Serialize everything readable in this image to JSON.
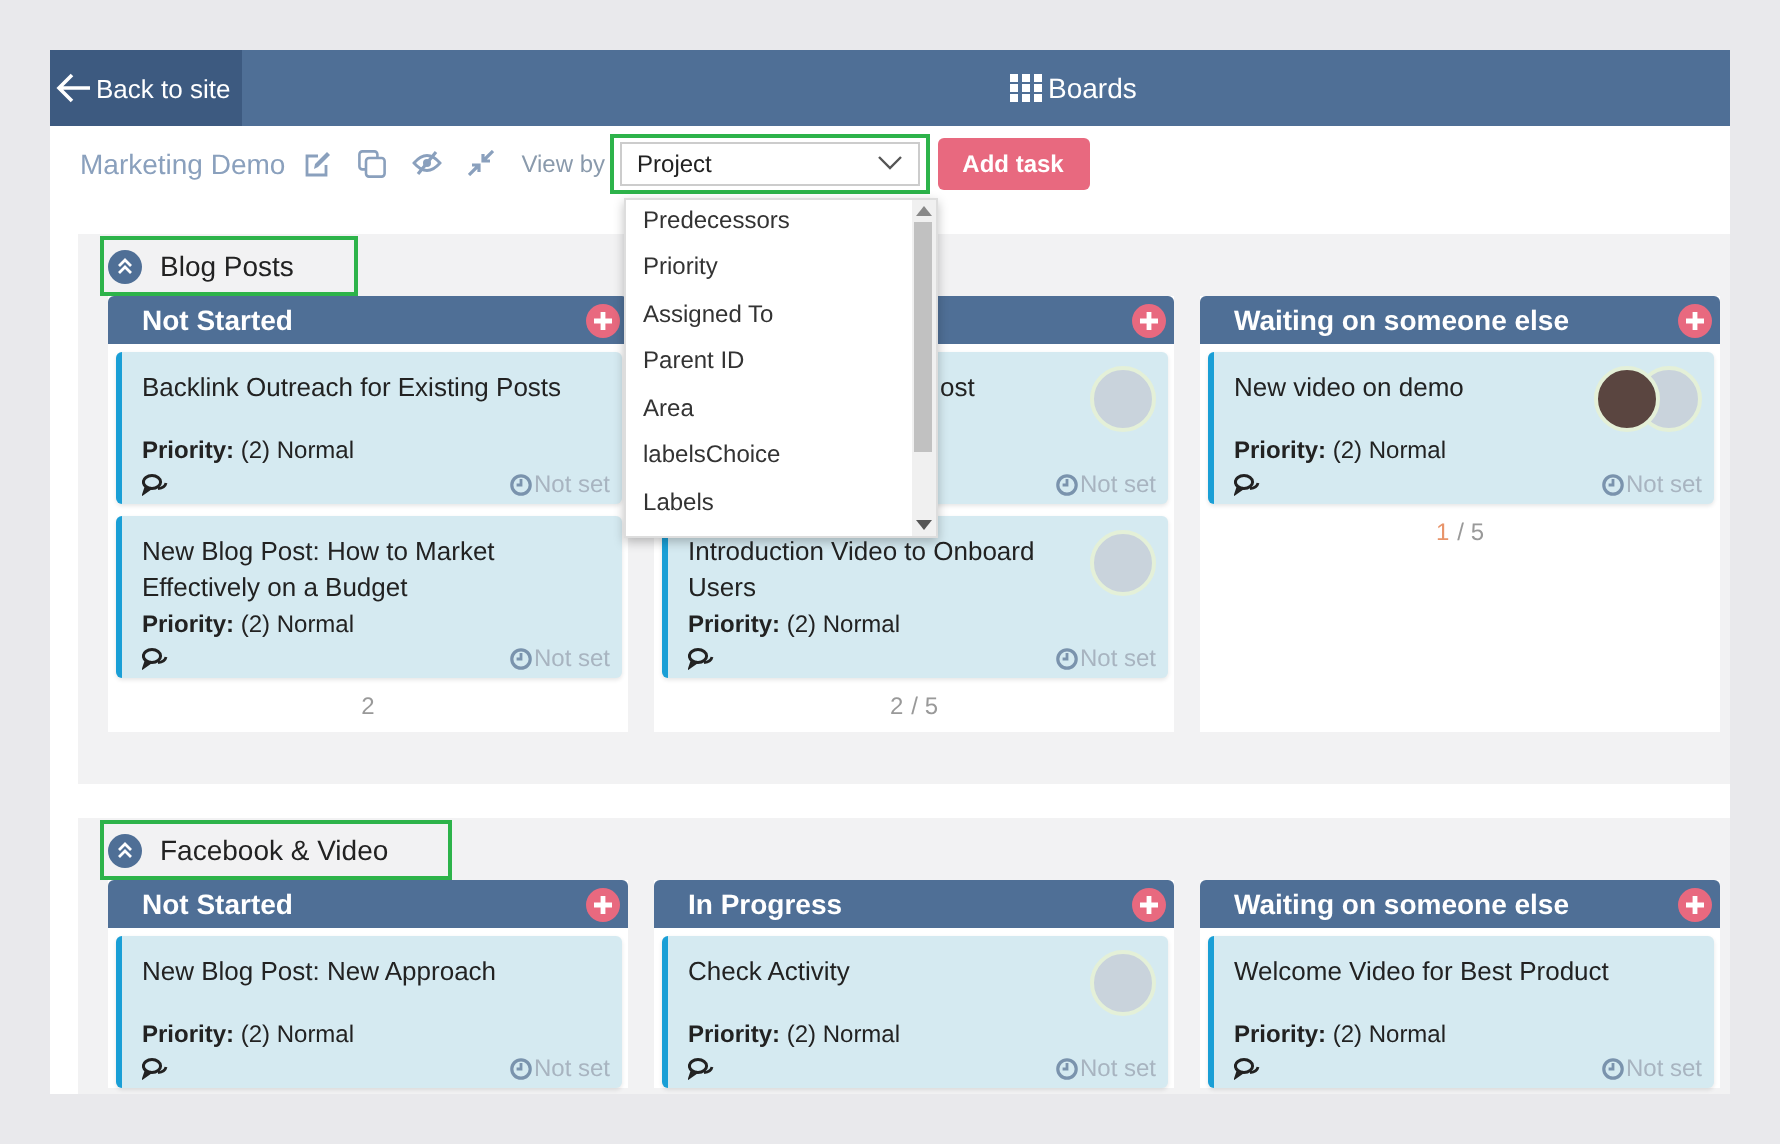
{
  "header": {
    "back_label": "Back to site",
    "title": "Boards"
  },
  "toolbar": {
    "board_name": "Marketing Demo",
    "view_by_label": "View by",
    "view_by": {
      "value": "Project",
      "highlighted": true,
      "expanded": true,
      "options": [
        "Predecessors",
        "Priority",
        "Assigned To",
        "Parent ID",
        "Area",
        "labelsChoice",
        "Labels"
      ]
    },
    "add_button": "Add task"
  },
  "sections": [
    {
      "title": "Blog Posts",
      "highlighted": true,
      "columns": [
        {
          "title": "Not Started",
          "cards": [
            {
              "title": "Backlink Outreach for Existing Posts",
              "covered": false,
              "priority_label": "Priority:",
              "priority": "(2) Normal",
              "due": "Not set"
            },
            {
              "title": "New Blog Post: How to Market Effectively on a Budget",
              "covered": false,
              "priority_label": "Priority:",
              "priority": "(2) Normal",
              "due": "Not set"
            }
          ],
          "footer": {
            "count": "2",
            "highlight": false
          }
        },
        {
          "cards": [
            {
              "title": "ost",
              "covered": true,
              "due": "Not set",
              "assignees": [
                {
                  "kind": "photo"
                }
              ]
            },
            {
              "title": "Introduction Video to Onboard Users",
              "covered": false,
              "priority_label": "Priority:",
              "priority": "(2) Normal",
              "due": "Not set",
              "assignees": [
                {
                  "kind": "photo"
                }
              ]
            }
          ],
          "footer": {
            "count": "2",
            "separator": "/",
            "total": "5",
            "highlight": false
          }
        },
        {
          "title": "Waiting on someone else",
          "cards": [
            {
              "title": "New video on demo",
              "covered": false,
              "priority_label": "Priority:",
              "priority": "(2) Normal",
              "due": "Not set",
              "assignees": [
                {
                  "kind": "photo"
                },
                {
                  "kind": "photo"
                }
              ]
            }
          ],
          "footer": {
            "count": "1",
            "separator": "/",
            "total": "5",
            "highlight": true
          }
        }
      ]
    },
    {
      "title": "Facebook & Video",
      "highlighted": true,
      "columns": [
        {
          "title": "Not Started",
          "cards": [
            {
              "title": "New Blog Post: New Approach",
              "covered": false,
              "priority_label": "Priority:",
              "priority": "(2) Normal",
              "due": "Not set"
            }
          ]
        },
        {
          "title": "In Progress",
          "cards": [
            {
              "title": "Check Activity",
              "covered": false,
              "priority_label": "Priority:",
              "priority": "(2) Normal",
              "due": "Not set",
              "assignees": [
                {
                  "kind": "photo"
                }
              ]
            }
          ]
        },
        {
          "title": "Waiting on someone else",
          "cards": [
            {
              "title": "Welcome Video for Best Product",
              "covered": false,
              "priority_label": "Priority:",
              "priority": "(2) Normal",
              "due": "Not set"
            }
          ]
        }
      ]
    }
  ]
}
